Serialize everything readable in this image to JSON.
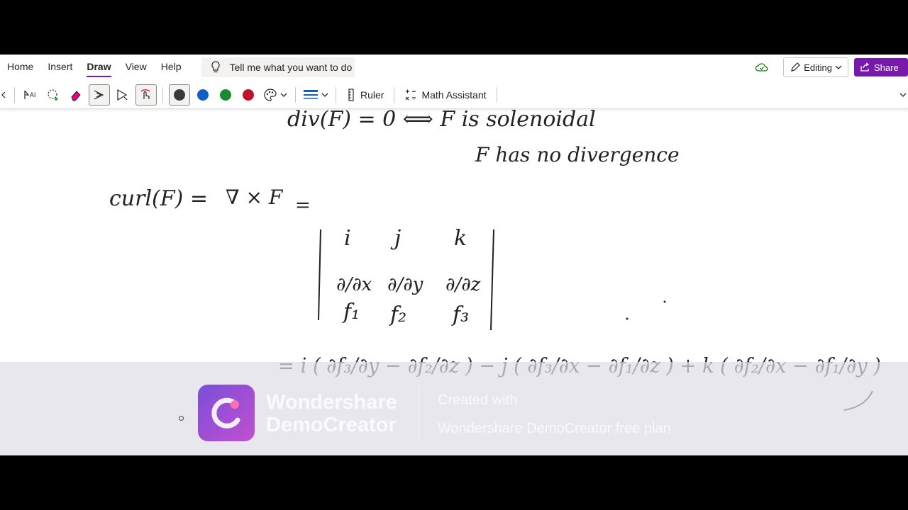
{
  "menu": {
    "items": [
      {
        "label": "Home"
      },
      {
        "label": "Insert"
      },
      {
        "label": "Draw"
      },
      {
        "label": "View"
      },
      {
        "label": "Help"
      }
    ],
    "active": "Draw",
    "tell_me": "Tell me what you want to do",
    "editing_label": "Editing",
    "share_label": "Share"
  },
  "toolbar": {
    "ruler_label": "Ruler",
    "math_label": "Math Assistant",
    "pen_colors": [
      "#3b3a39",
      "#0f5fc2",
      "#1a8a2f",
      "#c3102a"
    ]
  },
  "ink": {
    "line1": "div(F) = 0  ⟺  F  is  solenoidal",
    "line2": "F has no divergence",
    "curl_lhs": "curl(F) =",
    "nabla": "∇ × F",
    "matrix_row1": [
      "i",
      "j",
      "k"
    ],
    "matrix_row2": [
      "∂/∂x",
      "∂/∂y",
      "∂/∂z"
    ],
    "matrix_row3": [
      "f₁",
      "f₂",
      "f₃"
    ],
    "expansion": "= i ( ∂f₃/∂y − ∂f₂/∂z ) − j ( ∂f₃/∂x − ∂f₁/∂z ) + k ( ∂f₂/∂x − ∂f₁/∂y )"
  },
  "watermark": {
    "brand_line1": "Wondershare",
    "brand_line2": "DemoCreator",
    "created_line1": "Created with",
    "created_line2": "Wondershare DemoCreator free plan"
  }
}
